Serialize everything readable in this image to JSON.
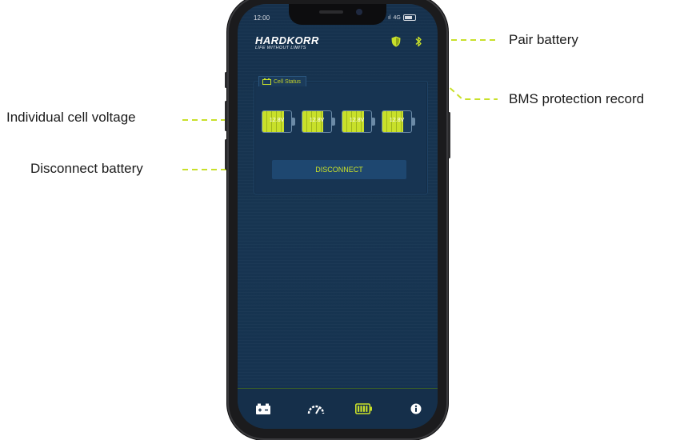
{
  "status_bar": {
    "time": "12:00",
    "network": "4G"
  },
  "app": {
    "brand": "HARDKORR",
    "tagline": "LIFE WITHOUT LIMITS"
  },
  "header_icons": {
    "shield": "shield-icon",
    "bluetooth": "bluetooth-icon"
  },
  "cell_status": {
    "title": "Cell Status",
    "cells": [
      {
        "label": "12.8V",
        "level": 0.75
      },
      {
        "label": "12.8V",
        "level": 0.72
      },
      {
        "label": "12.8V",
        "level": 0.74
      },
      {
        "label": "12.8V",
        "level": 0.71
      }
    ]
  },
  "disconnect_button": "DISCONNECT",
  "tabbar": [
    "battery-status-icon",
    "gauge-icon",
    "battery-cells-icon",
    "info-icon"
  ],
  "callouts": {
    "pair_battery": "Pair battery",
    "bms_record": "BMS protection record",
    "cell_voltage": "Individual cell voltage",
    "disconnect": "Disconnect battery"
  },
  "colors": {
    "accent": "#c8e02a",
    "screen_bg": "#163250",
    "callout_line": "#c8e02a"
  }
}
